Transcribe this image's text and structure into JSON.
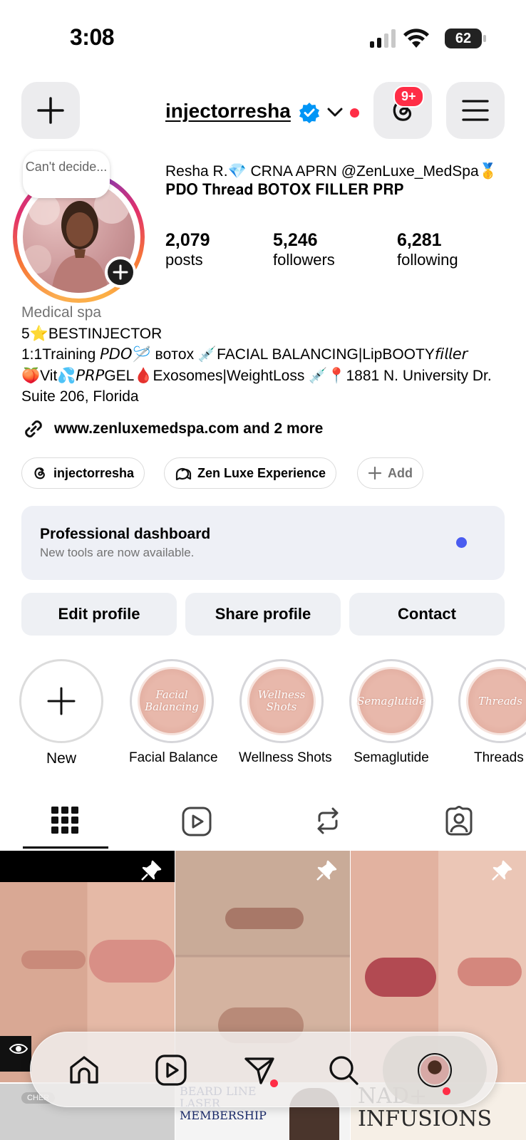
{
  "status_bar": {
    "time": "3:08",
    "battery": "62"
  },
  "header": {
    "username": "injectorresha",
    "notification_count": "9+"
  },
  "note": {
    "text": "Can't decide..."
  },
  "profile": {
    "display_name": "Resha R.💎 CRNA APRN @ZenLuxe_MedSpa🥇𝐏𝐃𝐎 𝐓𝐡𝐫𝐞𝐚𝐝 𝐁𝐎𝐓𝐎𝐗 𝐅𝐈𝐋𝐋𝐄𝐑 𝐏𝐑𝐏",
    "stats": [
      {
        "value": "2,079",
        "label": "posts"
      },
      {
        "value": "5,246",
        "label": "followers"
      },
      {
        "value": "6,281",
        "label": "following"
      }
    ],
    "category": "Medical spa",
    "bio_lines": [
      "5⭐️BESTINJECTOR",
      "1:1Training 𝘗𝘋𝘖🪡 ʙᴏᴛᴏx 💉FACIAL BALANCING|LipBOOTY𝘧𝘪𝘭𝘭𝘦𝘳",
      "🍑Vit💦𝘗𝘙𝘗GEL🩸Exosomes|WeightLoss 💉📍1881 N. University Dr. Suite 206, Florida"
    ],
    "link_text": "www.zenluxemedspa.com and 2 more"
  },
  "chips": [
    {
      "label": "injectorresha",
      "icon": "threads-icon"
    },
    {
      "label": "Zen Luxe Experience",
      "icon": "chat-icon"
    },
    {
      "label": "Add",
      "icon": "plus-icon"
    }
  ],
  "dashboard": {
    "title": "Professional dashboard",
    "subtitle": "New tools are now available."
  },
  "buttons": {
    "edit": "Edit profile",
    "share": "Share profile",
    "contact": "Contact"
  },
  "highlights": [
    {
      "label": "New",
      "cover_text": ""
    },
    {
      "label": "Facial Balance",
      "cover_text": "Facial Balancing"
    },
    {
      "label": "Wellness Shots",
      "cover_text": "Wellness Shots"
    },
    {
      "label": "Semaglutide",
      "cover_text": "Semaglutide"
    },
    {
      "label": "Threads",
      "cover_text": "Threads"
    }
  ],
  "grid_posts_bottom": {
    "post4_tag": "CHER",
    "post5_text": "BEARD LINE LASER MEMBERSHIP",
    "post6_text": "NAD+ INFUSIONS"
  },
  "colors": {
    "accent_blue": "#0095f6",
    "notif_red": "#ff2d46",
    "dashboard_dot": "#4a5cf0"
  }
}
